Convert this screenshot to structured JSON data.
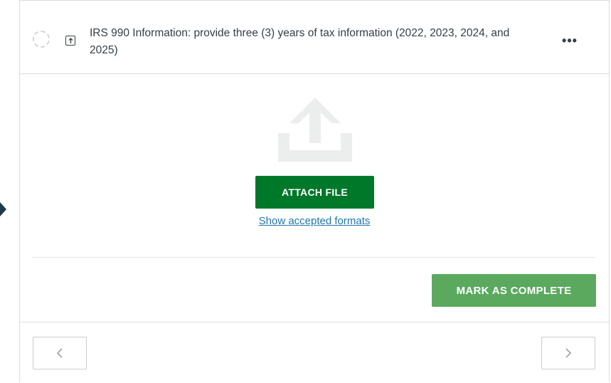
{
  "task": {
    "title": "IRS 990 Information: provide three (3) years of tax information (2022, 2023, 2024, and 2025)",
    "status_icon": "pending-dashed-circle-icon",
    "type_icon": "file-upload-icon",
    "more_label": "•••"
  },
  "upload": {
    "icon": "upload-tray-icon",
    "attach_label": "ATTACH FILE",
    "formats_link": "Show accepted formats"
  },
  "actions": {
    "complete_label": "MARK AS COMPLETE"
  },
  "navigation": {
    "prev_icon": "chevron-left-icon",
    "next_icon": "chevron-right-icon"
  },
  "colors": {
    "attach_button": "#00782a",
    "complete_button": "#5aa95f",
    "link": "#2277a8",
    "text": "#333e48"
  }
}
